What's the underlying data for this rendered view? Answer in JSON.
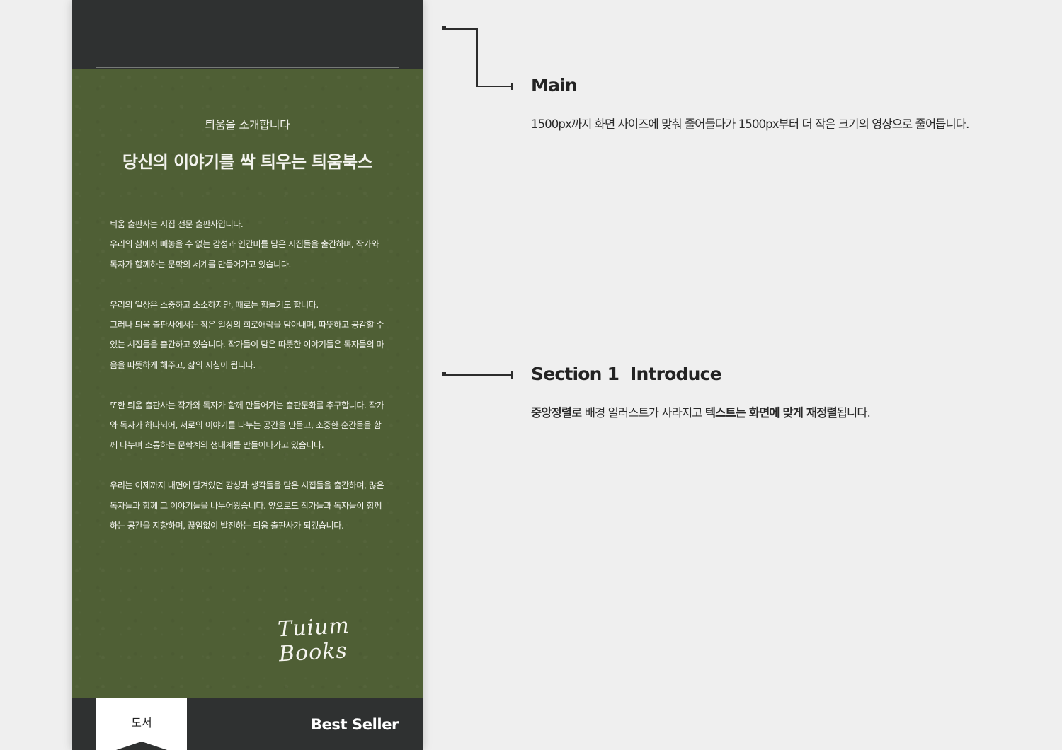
{
  "mock": {
    "intro_sub": "틔움을 소개합니다",
    "intro_title": "당신의 이야기를 싹 틔우는 틔움북스",
    "paragraphs": [
      "틔움 출판사는 시집 전문 출판사입니다.\n우리의 삶에서 빼놓을 수 없는 감성과 인간미를 담은 시집들을 출간하며, 작가와 독자가 함께하는 문학의 세계를 만들어가고 있습니다.",
      "우리의 일상은 소중하고 소소하지만, 때로는 힘들기도 합니다.\n그러나 틔움 출판사에서는 작은 일상의 희로애락을 담아내며, 따뜻하고 공감할 수 있는 시집들을 출간하고 있습니다. 작가들이 담은 따뜻한 이야기들은 독자들의 마음을 따뜻하게 해주고, 삶의 지침이 됩니다.",
      "또한 틔움 출판사는 작가와 독자가 함께 만들어가는 출판문화를 추구합니다. 작가와 독자가 하나되어, 서로의 이야기를 나누는 공간을 만들고, 소중한 순간들을 함께 나누며 소통하는 문학계의 생태계를 만들어나가고 있습니다.",
      "우리는 이제까지 내면에 담겨있던 감성과 생각들을 담은 시집들을 출간하며, 많은 독자들과 함께 그 이야기들을 나누어왔습니다. 앞으로도 작가들과 독자들이 함께 하는 공간을 지향하며, 끊임없이 발전하는 틔움 출판사가 되겠습니다."
    ],
    "signature": "Tuium Books",
    "tab_book": "도서",
    "best_seller": "Best Seller"
  },
  "annotations": {
    "main_title": "Main",
    "main_desc": "1500px까지 화면 사이즈에 맞춰 줄어들다가 1500px부터 더 작은 크기의 영상으로 줄어듭니다.",
    "section1_title": "Section 1  Introduce",
    "section1_desc": {
      "bold1": "중앙정렬",
      "text1": "로 배경 일러스트가 사라지고 ",
      "bold2": "텍스트는 화면에 맞게 재정렬",
      "text2": "됩니다."
    }
  }
}
